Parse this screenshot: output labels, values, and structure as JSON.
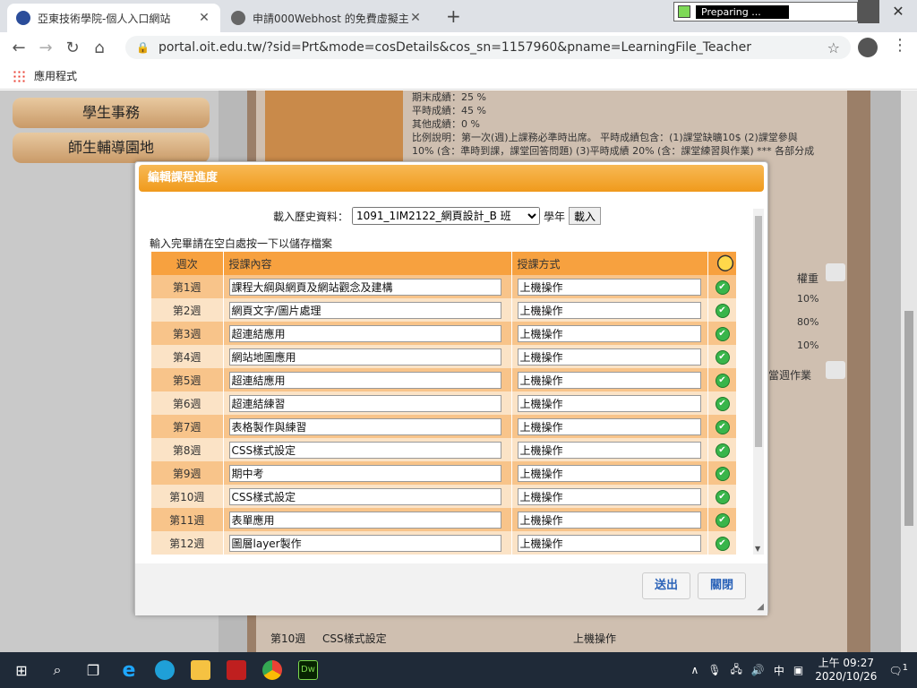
{
  "browser": {
    "tabs": [
      {
        "title": "亞東技術學院-個人入口網站",
        "active": true
      },
      {
        "title": "申請000Webhost 的免費虛擬主",
        "active": false
      }
    ],
    "preparing_text": "Preparing ...",
    "url": "portal.oit.edu.tw/?sid=Prt&mode=cosDetails&cos_sn=1157960&pname=LearningFile_Teacher",
    "bookmark": "應用程式"
  },
  "left_nav": {
    "items": [
      "學生事務",
      "師生輔導園地"
    ]
  },
  "background": {
    "grading_lines": [
      "期末成績：25 %",
      "平時成績：45 %",
      "其他成績：0 %",
      "比例說明：第一次(週)上課務必準時出席。 平時成績包含：(1)課堂缺曠10$ (2)課堂參與",
      "10% (含：準時到課，課堂回答問題) (3)平時成績 20% (含：課堂練習與作業) *** 各部分成"
    ],
    "weight_header": "權重",
    "weights": [
      "10%",
      "80%",
      "10%"
    ],
    "weekly_work": "當週作業",
    "bottom_row": {
      "week": "第10週",
      "content": "CSS樣式設定",
      "method": "上機操作"
    }
  },
  "modal": {
    "title": "編輯課程進度",
    "load_label": "載入歷史資料：",
    "load_select": "1091_1IM2122_網頁設計_B 班",
    "year_label": "學年",
    "load_button": "載入",
    "hint": "輸入完畢請在空白處按一下以儲存檔案",
    "columns": {
      "week": "週次",
      "content": "授課內容",
      "method": "授課方式"
    },
    "rows": [
      {
        "week": "第1週",
        "content": "課程大綱與網頁及網站觀念及建構",
        "method": "上機操作"
      },
      {
        "week": "第2週",
        "content": "網頁文字/圖片處理",
        "method": "上機操作"
      },
      {
        "week": "第3週",
        "content": "超連結應用",
        "method": "上機操作"
      },
      {
        "week": "第4週",
        "content": "網站地圖應用",
        "method": "上機操作"
      },
      {
        "week": "第5週",
        "content": "超連結應用",
        "method": "上機操作"
      },
      {
        "week": "第6週",
        "content": "超連結練習",
        "method": "上機操作"
      },
      {
        "week": "第7週",
        "content": "表格製作與練習",
        "method": "上機操作"
      },
      {
        "week": "第8週",
        "content": "CSS樣式設定",
        "method": "上機操作"
      },
      {
        "week": "第9週",
        "content": "期中考",
        "method": "上機操作"
      },
      {
        "week": "第10週",
        "content": "CSS樣式設定",
        "method": "上機操作"
      },
      {
        "week": "第11週",
        "content": "表單應用",
        "method": "上機操作"
      },
      {
        "week": "第12週",
        "content": "圖層layer製作",
        "method": "上機操作"
      }
    ],
    "send_button": "送出",
    "close_button": "關閉"
  },
  "taskbar": {
    "time": "上午 09:27",
    "date": "2020/10/26",
    "ime": "中",
    "notifications": "1"
  }
}
